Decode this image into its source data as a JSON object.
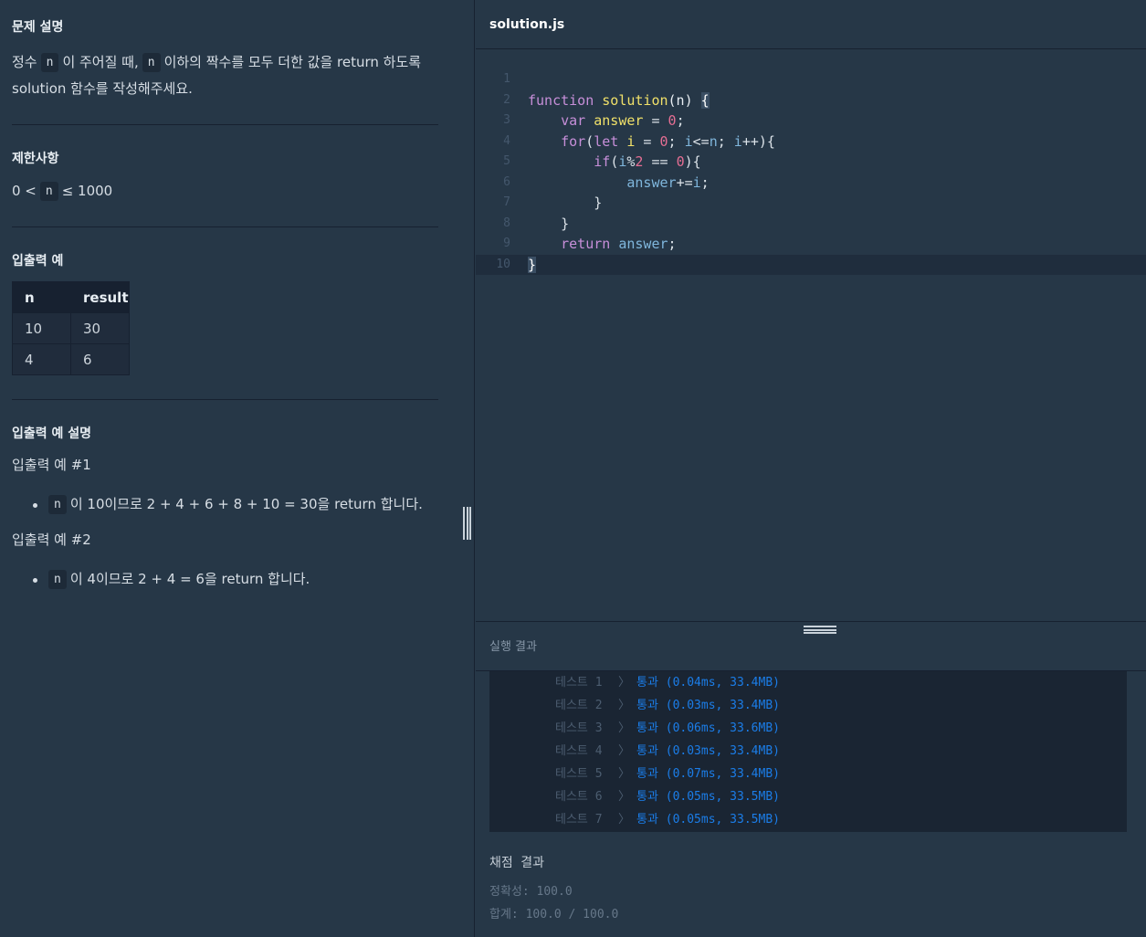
{
  "problem": {
    "desc_title": "문제 설명",
    "desc_line1_a": "정수",
    "desc_code": "n",
    "desc_line1_b": "이 주어질 때,",
    "desc_line1_c": "이하의 짝수를 모두 더한 값을 return 하도록",
    "desc_line2": "solution 함수를 작성해주세요.",
    "constraints_title": "제한사항",
    "constraint_lt": "0 <",
    "constraint_le": "≤ 1000",
    "io_title": "입출력 예",
    "io_table": {
      "headers": [
        "n",
        "result"
      ],
      "rows": [
        [
          "10",
          "30"
        ],
        [
          "4",
          "6"
        ]
      ]
    },
    "explain_title": "입출력 예 설명",
    "ex1_title": "입출력 예 #1",
    "ex1_text": "이 10이므로 2 + 4 + 6 + 8 + 10 = 30을 return 합니다.",
    "ex2_title": "입출력 예 #2",
    "ex2_text": "이 4이므로 2 + 4 = 6을 return 합니다."
  },
  "editor": {
    "filename": "solution.js",
    "line_numbers": [
      "1",
      "2",
      "3",
      "4",
      "5",
      "6",
      "7",
      "8",
      "9",
      "10"
    ],
    "code": {
      "l2_kw": "function",
      "l2_fn": "solution",
      "l2_rest": "(n) ",
      "l2_brace": "{",
      "l3_kw": "var",
      "l3_var": "answer",
      "l3_eq": " = ",
      "l3_num": "0",
      "l3_end": ";",
      "l4_kw": "for",
      "l4_a": "(",
      "l4_let": "let",
      "l4_i": "i",
      "l4_eq": " = ",
      "l4_zero": "0",
      "l4_b": "; ",
      "l4_i2": "i",
      "l4_le": "<=",
      "l4_n": "n",
      "l4_c": "; ",
      "l4_i3": "i",
      "l4_d": "++){",
      "l5_kw": "if",
      "l5_a": "(",
      "l5_i": "i",
      "l5_mod": "%",
      "l5_two": "2",
      "l5_eq": " == ",
      "l5_zero": "0",
      "l5_b": "){",
      "l6_var": "answer",
      "l6_op": "+=",
      "l6_i": "i",
      "l6_end": ";",
      "l7": "}",
      "l8": "}",
      "l9_kw": "return",
      "l9_var": "answer",
      "l9_end": ";",
      "l10": "}"
    }
  },
  "results": {
    "title": "실행 결과",
    "tests": [
      {
        "name": "테스트 1",
        "sep": "〉",
        "result": "통과 (0.04ms, 33.4MB)"
      },
      {
        "name": "테스트 2",
        "sep": "〉",
        "result": "통과 (0.03ms, 33.4MB)"
      },
      {
        "name": "테스트 3",
        "sep": "〉",
        "result": "통과 (0.06ms, 33.6MB)"
      },
      {
        "name": "테스트 4",
        "sep": "〉",
        "result": "통과 (0.03ms, 33.4MB)"
      },
      {
        "name": "테스트 5",
        "sep": "〉",
        "result": "통과 (0.07ms, 33.4MB)"
      },
      {
        "name": "테스트 6",
        "sep": "〉",
        "result": "통과 (0.05ms, 33.5MB)"
      },
      {
        "name": "테스트 7",
        "sep": "〉",
        "result": "통과 (0.05ms, 33.5MB)"
      }
    ]
  },
  "grading": {
    "title": "채점 결과",
    "accuracy": "정확성: 100.0",
    "total": "합계: 100.0 / 100.0"
  },
  "colors": {
    "background": "#263747",
    "border": "#172130",
    "pass": "#1b7de8"
  }
}
